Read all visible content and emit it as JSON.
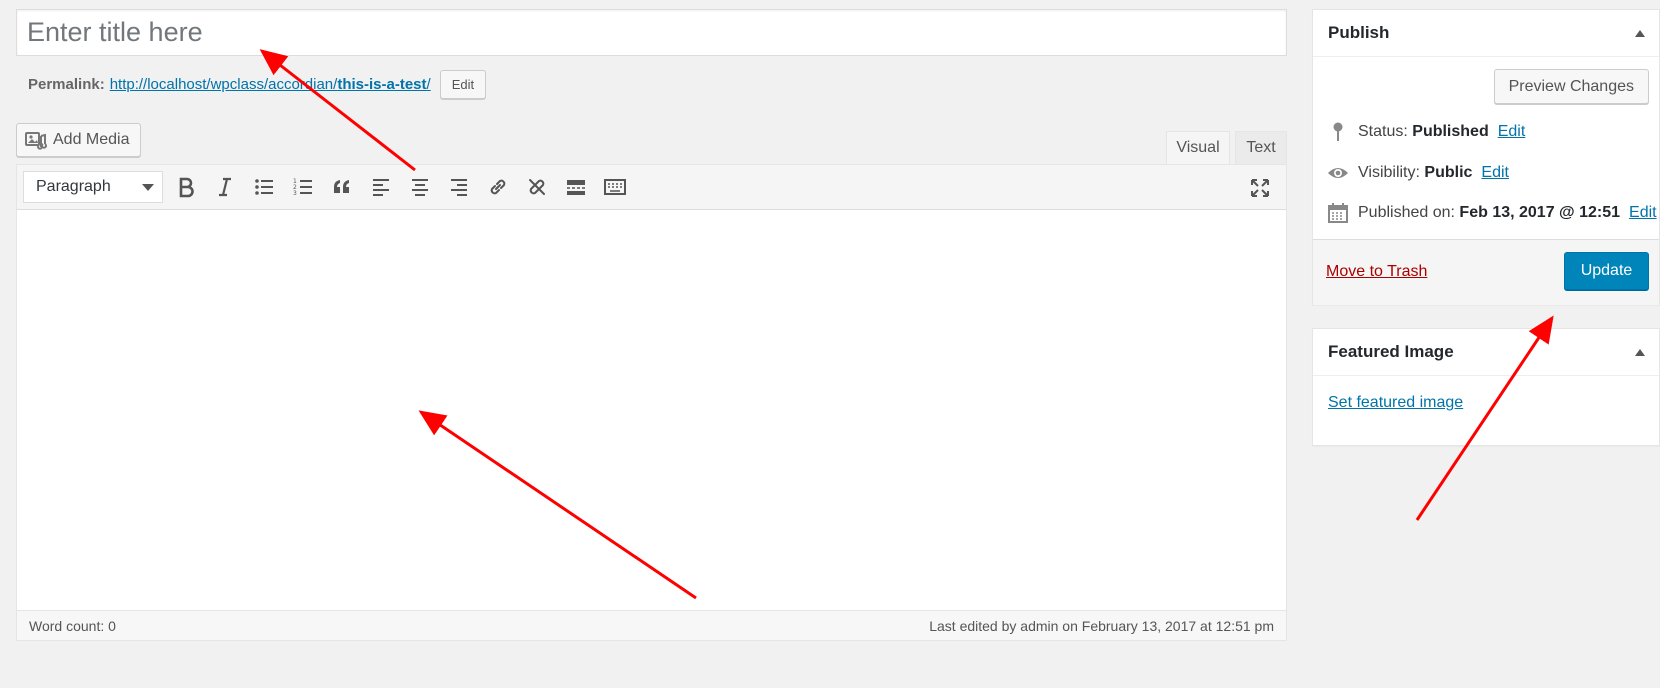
{
  "title": {
    "placeholder": "Enter title here",
    "value": ""
  },
  "permalink": {
    "label": "Permalink:",
    "url_base": "http://localhost/wpclass/accordian/",
    "slug": "this-is-a-test",
    "url_trail": "/",
    "edit_label": "Edit"
  },
  "editor": {
    "add_media_label": "Add Media",
    "tabs": {
      "visual": "Visual",
      "text": "Text"
    },
    "format_select": "Paragraph",
    "toolbar_icons": [
      "bold-icon",
      "italic-icon",
      "bullet-list-icon",
      "numbered-list-icon",
      "blockquote-icon",
      "align-left-icon",
      "align-center-icon",
      "align-right-icon",
      "link-icon",
      "unlink-icon",
      "read-more-icon",
      "toolbar-toggle-icon",
      "fullscreen-icon"
    ],
    "word_count": "Word count: 0",
    "last_edited": "Last edited by admin on February 13, 2017 at 12:51 pm"
  },
  "publish": {
    "title": "Publish",
    "preview_label": "Preview Changes",
    "status_label": "Status:",
    "status_value": "Published",
    "visibility_label": "Visibility:",
    "visibility_value": "Public",
    "published_label": "Published on:",
    "published_value": "Feb 13, 2017 @ 12:51",
    "edit_label": "Edit",
    "trash_label": "Move to Trash",
    "update_label": "Update"
  },
  "featured_image": {
    "title": "Featured Image",
    "set_label": "Set featured image"
  },
  "colors": {
    "accent": "#0085ba",
    "link": "#0073aa",
    "danger": "#a00",
    "annotation": "#ff0000"
  }
}
